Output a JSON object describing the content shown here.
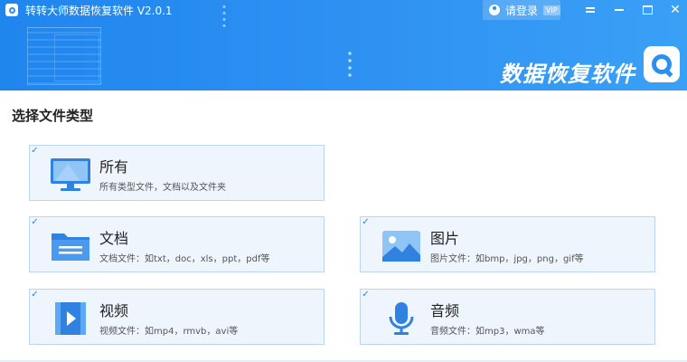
{
  "window": {
    "title": "转转大师数据恢复软件 V2.0.1",
    "login_label": "请登录",
    "vip_badge": "VIP"
  },
  "banner": {
    "title": "数据恢复软件"
  },
  "section_title": "选择文件类型",
  "file_types": [
    {
      "name": "所有",
      "desc": "所有类型文件，文档以及文件夹",
      "checked": true,
      "icon": "monitor-icon"
    },
    {
      "name": "文档",
      "desc": "文档文件：如txt，doc，xls，ppt，pdf等",
      "checked": true,
      "icon": "folder-icon"
    },
    {
      "name": "图片",
      "desc": "图片文件：如bmp，jpg，png，gif等",
      "checked": true,
      "icon": "image-icon"
    },
    {
      "name": "视频",
      "desc": "视频文件：如mp4，rmvb，avi等",
      "checked": true,
      "icon": "video-icon"
    },
    {
      "name": "音频",
      "desc": "音频文件：如mp3，wma等",
      "checked": true,
      "icon": "microphone-icon"
    }
  ],
  "colors": {
    "accent": "#2c8ff2",
    "card_bg": "#eef5fd",
    "card_border": "#bcd6f2"
  }
}
